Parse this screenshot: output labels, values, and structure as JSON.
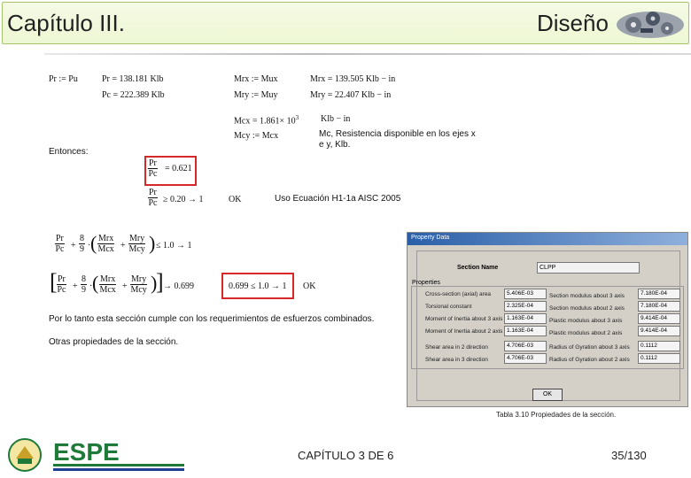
{
  "header": {
    "title_left": "Capítulo III.",
    "title_right": "Diseño"
  },
  "equations": {
    "pr_def": "Pr := Pu",
    "pr_val": "Pr = 138.181  Klb",
    "pc_val": "Pc = 222.389  Klb",
    "mrx_def": "Mrx := Mux",
    "mrx_val": "Mrx = 139.505  Klb − in",
    "mry_def": "Mry := Muy",
    "mry_val": "Mry = 22.407   Klb − in",
    "mcx_val": "Mcx = 1.861× 10",
    "mcx_exp": "3",
    "mcx_unit": "Klb − in",
    "mcy_def": "Mcy := Mcx",
    "mc_note_1": "Mc, Resistencia disponible en los ejes x",
    "mc_note_2": "e y, Klb.",
    "entonces": "Entonces:",
    "frac_pr": "Pr",
    "frac_pc": "Pc",
    "ratio_val": "= 0.621",
    "cond_1": "≥ 0.20 → 1",
    "ok_1": "OK",
    "uso_ec": "Uso Ecuación H1-1a AISC 2005",
    "eight": "8",
    "nine": "9",
    "mrx": "Mrx",
    "mcx": "Mcx",
    "mry": "Mry",
    "mcy": "Mcy",
    "plus": "+",
    "dot": "·",
    "ineq_1": "≤ 1.0 → 1",
    "eq_val": "→ 0.699",
    "boxed_result": "0.699 ≤ 1.0 → 1",
    "ok_2": "OK",
    "conclusion": "Por lo tanto esta sección cumple con los requerimientos de esfuerzos combinados.",
    "other_props": "Otras propiedades de la sección."
  },
  "dialog": {
    "title": "Property Data",
    "section_name_label": "Section Name",
    "section_name_value": "CLPP",
    "properties_label": "Properties",
    "left_props": [
      {
        "label": "Cross-section (axial) area",
        "value": "5.406E-03"
      },
      {
        "label": "Torsional constant",
        "value": "2.325E-04"
      },
      {
        "label": "Moment of Inertia about 3 axis",
        "value": "1.163E-04"
      },
      {
        "label": "Moment of Inertia about 2 axis",
        "value": "1.163E-04"
      },
      {
        "label": "Shear area in 2 direction",
        "value": "4.706E-03"
      },
      {
        "label": "Shear area in 3 direction",
        "value": "4.706E-03"
      }
    ],
    "right_props": [
      {
        "label": "Section modulus about 3 axis",
        "value": "7.180E-04"
      },
      {
        "label": "Section modulus about 2 axis",
        "value": "7.180E-04"
      },
      {
        "label": "Plastic modulus about 3 axis",
        "value": "9.414E-04"
      },
      {
        "label": "Plastic modulus about 2 axis",
        "value": "9.414E-04"
      },
      {
        "label": "Radius of Gyration about 3 axis",
        "value": "0.1112"
      },
      {
        "label": "Radius of Gyration about 2 axis",
        "value": "0.1112"
      }
    ],
    "ok_label": "OK"
  },
  "caption": "Tabla 3.10 Propiedades de la sección.",
  "footer": {
    "chapter": "CAPÍTULO 3 DE 6",
    "page": "35/130"
  },
  "logo": {
    "text": "ESPE",
    "colors": {
      "green": "#1f7a3a",
      "blue": "#1d3f8f"
    }
  }
}
